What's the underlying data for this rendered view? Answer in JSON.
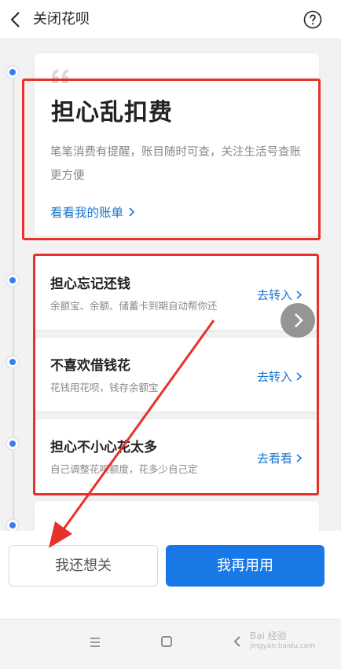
{
  "header": {
    "title": "关闭花呗",
    "back_icon": "chevron-left-icon",
    "help_icon": "question-circle-icon"
  },
  "feature_card": {
    "title": "担心乱扣费",
    "description": "笔笔消费有提醒，账目随时可查，关注生活号查账更方便",
    "link_label": "看看我的账单"
  },
  "items": [
    {
      "title": "担心忘记还钱",
      "description": "余额宝、余额、储蓄卡到期自动帮你还",
      "action": "去转入"
    },
    {
      "title": "不喜欢借钱花",
      "description": "花钱用花呗，钱存余额宝",
      "action": "去转入"
    },
    {
      "title": "担心不小心花太多",
      "description": "自己调整花呗额度，花多少自己定",
      "action": "去看看"
    }
  ],
  "buttons": {
    "secondary": "我还想关",
    "primary": "我再用用"
  },
  "watermark": {
    "main": "Bai 经验",
    "sub": "jingyan.baidu.com"
  },
  "colors": {
    "accent": "#1878e6",
    "link": "#1677d2",
    "annotation": "#e8312a",
    "timeline_dot": "#3c7cf1"
  }
}
